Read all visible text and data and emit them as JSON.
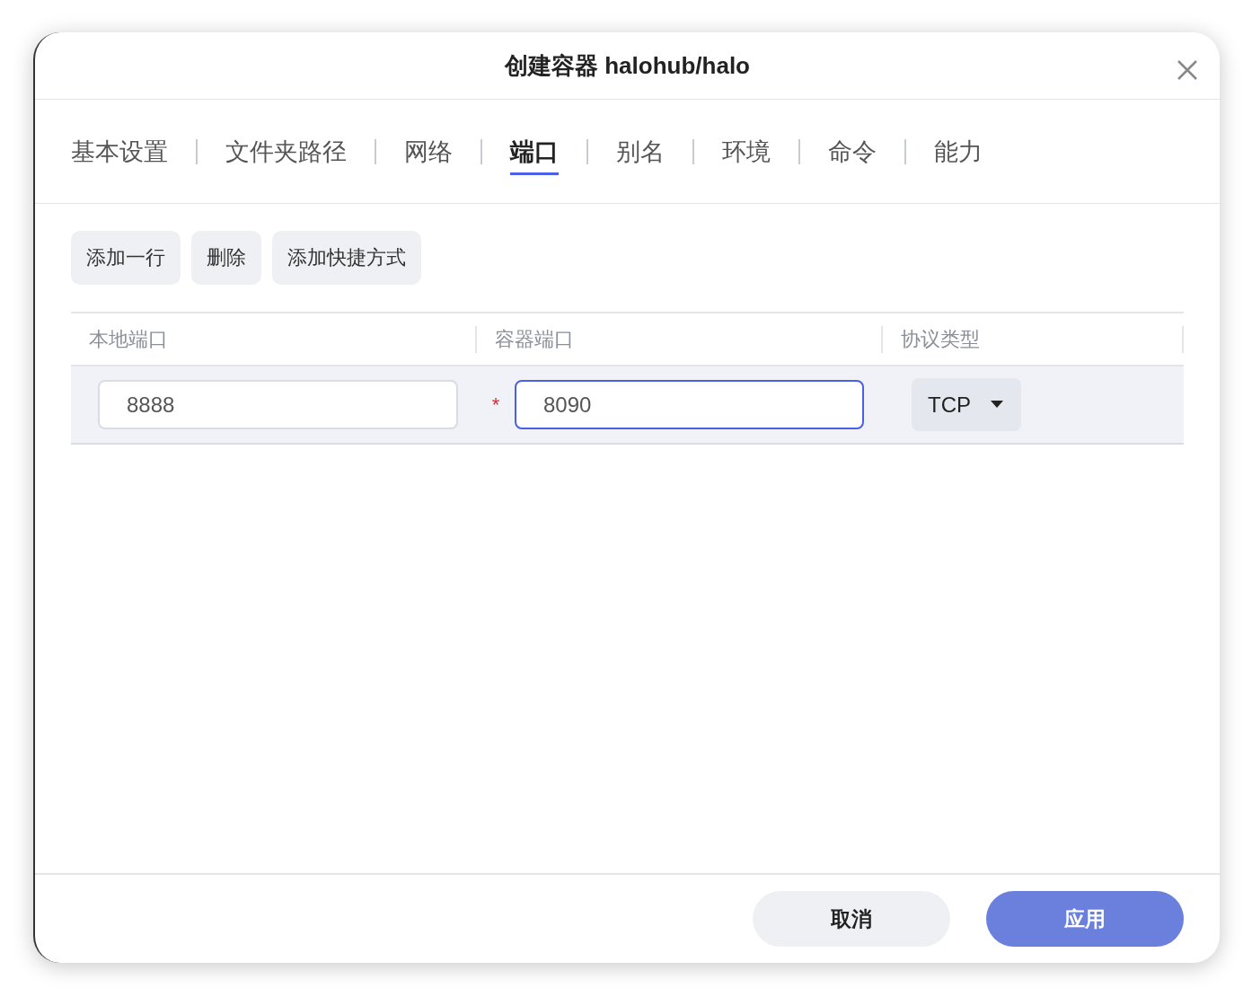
{
  "dialog": {
    "title": "创建容器 halohub/halo"
  },
  "tabs": [
    {
      "label": "基本设置",
      "selected": false
    },
    {
      "label": "文件夹路径",
      "selected": false
    },
    {
      "label": "网络",
      "selected": false
    },
    {
      "label": "端口",
      "selected": true
    },
    {
      "label": "别名",
      "selected": false
    },
    {
      "label": "环境",
      "selected": false
    },
    {
      "label": "命令",
      "selected": false
    },
    {
      "label": "能力",
      "selected": false
    }
  ],
  "toolbar": [
    "添加一行",
    "删除",
    "添加快捷方式"
  ],
  "table": {
    "columns": [
      "本地端口",
      "容器端口",
      "协议类型"
    ],
    "rows": [
      {
        "local_port": {
          "value": "8888",
          "focused": false
        },
        "container_port": {
          "required_mark": "*",
          "value": "8090",
          "focused": true
        },
        "protocol": "TCP"
      }
    ]
  },
  "footer": [
    {
      "label": "取消",
      "kind": "secondary"
    },
    {
      "label": "应用",
      "kind": "primary"
    }
  ]
}
